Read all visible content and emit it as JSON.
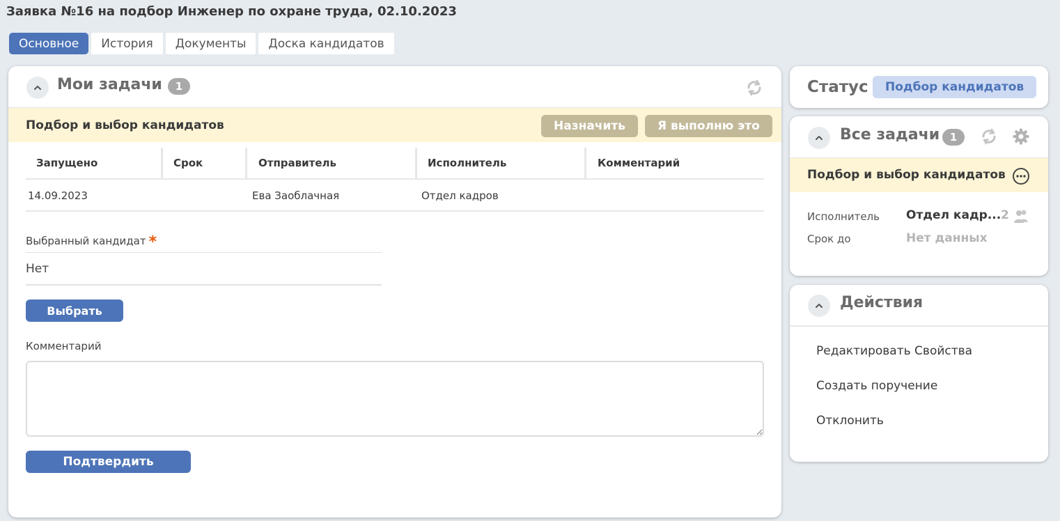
{
  "page": {
    "title": "Заявка №16 на подбор Инженер по охране труда, 02.10.2023"
  },
  "tabs": [
    {
      "label": "Основное",
      "active": true
    },
    {
      "label": "История"
    },
    {
      "label": "Документы"
    },
    {
      "label": "Доска кандидатов"
    }
  ],
  "my_tasks": {
    "title": "Мои задачи",
    "count": "1",
    "task_title": "Подбор и выбор кандидатов",
    "assign_label": "Назначить",
    "do_it_label": "Я выполню это",
    "columns": [
      "Запущено",
      "Срок",
      "Отправитель",
      "Исполнитель",
      "Комментарий"
    ],
    "row": {
      "started": "14.09.2023",
      "deadline": "",
      "sender": "Ева Заоблачная",
      "executor": "Отдел кадров",
      "comment": ""
    },
    "candidate_label": "Выбранный кандидат",
    "required_mark": "*",
    "candidate_value": "Нет",
    "choose_label": "Выбрать",
    "comment_label": "Комментарий",
    "comment_value": "",
    "confirm_label": "Подтвердить"
  },
  "status": {
    "label": "Статус",
    "value": "Подбор кандидатов"
  },
  "all_tasks": {
    "title": "Все задачи",
    "count": "1",
    "task_title": "Подбор и выбор кандидатов",
    "executor_label": "Исполнитель",
    "executor_value": "Отдел кадр...",
    "executor_count": "2",
    "due_label": "Срок до",
    "due_value": "Нет данных"
  },
  "actions": {
    "title": "Действия",
    "items": [
      "Редактировать Свойства",
      "Создать поручение",
      "Отклонить"
    ]
  },
  "icons": [
    "chevron-up-icon",
    "refresh-icon",
    "gear-icon",
    "more-icon",
    "users-icon"
  ],
  "colors": {
    "primary": "#4d74b8",
    "banner": "#fdf5d6",
    "banner_button": "#c2b999",
    "status_pill": "#cddaf2",
    "background": "#e6ebf0",
    "required": "#e8590c"
  }
}
